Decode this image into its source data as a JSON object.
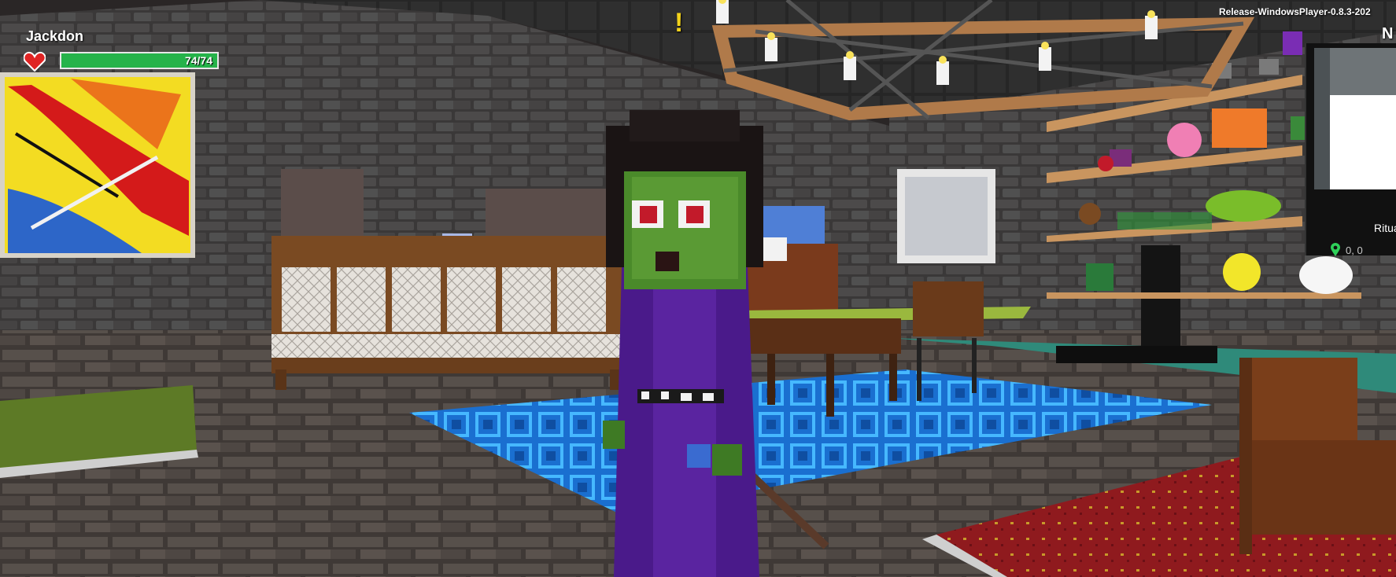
{
  "player": {
    "name": "Jackdon",
    "health_text": "74/74",
    "health_fraction": 1.0
  },
  "build": {
    "label": "Release-WindowsPlayer-0.8.3-202"
  },
  "quest_marker": "!",
  "minimap": {
    "compass": "N",
    "location": "Ritua",
    "coords": "0, 0"
  },
  "icons": {
    "heart": "heart-icon",
    "pin": "map-pin-icon"
  },
  "colors": {
    "health_fill": "#26b34a",
    "heart": "#e02424",
    "quest_marker": "#f2d21b",
    "pin": "#2fd05a"
  }
}
